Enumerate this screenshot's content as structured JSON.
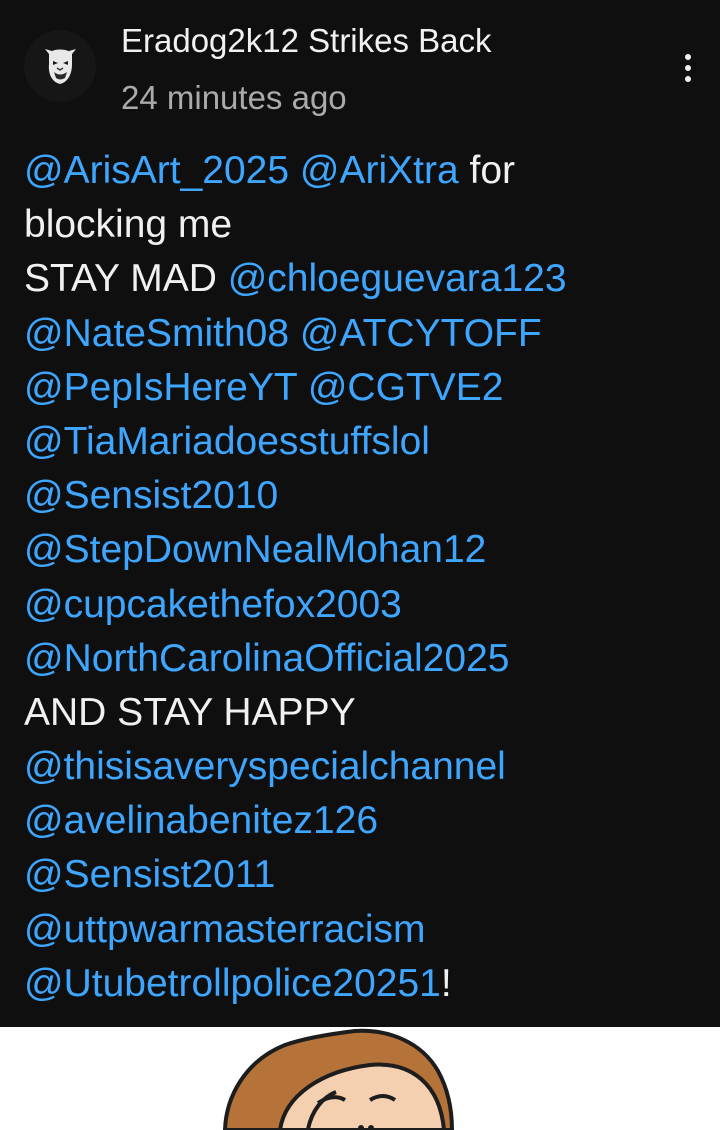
{
  "comment": {
    "author": "Eradog2k12 Strikes Back",
    "timestamp": "24 minutes ago",
    "menu_icon": "more-vert-icon",
    "lines": [
      [
        {
          "text": "@ArisArt_2025",
          "mention": true
        },
        {
          "text": " ",
          "mention": false
        },
        {
          "text": "@AriXtra",
          "mention": true
        },
        {
          "text": " for",
          "mention": false
        }
      ],
      [
        {
          "text": "blocking me",
          "mention": false
        }
      ],
      [
        {
          "text": "STAY MAD ",
          "mention": false
        },
        {
          "text": "@chloeguevara123",
          "mention": true
        }
      ],
      [
        {
          "text": "@NateSmith08",
          "mention": true
        },
        {
          "text": " ",
          "mention": false
        },
        {
          "text": "@ATCYTOFF",
          "mention": true
        }
      ],
      [
        {
          "text": "@PepIsHereYT",
          "mention": true
        },
        {
          "text": " ",
          "mention": false
        },
        {
          "text": "@CGTVE2",
          "mention": true
        }
      ],
      [
        {
          "text": "@TiaMariadoesstuffslol",
          "mention": true
        }
      ],
      [
        {
          "text": "@Sensist2010",
          "mention": true
        }
      ],
      [
        {
          "text": "@StepDownNealMohan12",
          "mention": true
        }
      ],
      [
        {
          "text": "@cupcakethefox2003",
          "mention": true
        }
      ],
      [
        {
          "text": "@NorthCarolinaOfficial2025",
          "mention": true
        }
      ],
      [
        {
          "text": "AND STAY HAPPY",
          "mention": false
        }
      ],
      [
        {
          "text": "@thisisaveryspecialchannel",
          "mention": true
        }
      ],
      [
        {
          "text": "@avelinabenitez126",
          "mention": true
        }
      ],
      [
        {
          "text": "@Sensist2011",
          "mention": true
        }
      ],
      [
        {
          "text": "@uttpwarmasterracism",
          "mention": true
        }
      ],
      [
        {
          "text": "@Utubetrollpolice20251",
          "mention": true
        },
        {
          "text": "!",
          "mention": false
        }
      ]
    ]
  },
  "colors": {
    "background": "#0f0f0f",
    "text": "#f1f1f1",
    "secondary_text": "#aaaaaa",
    "mention": "#3ea6ff"
  },
  "attached_image": {
    "subject": "cartoon-character-face"
  }
}
